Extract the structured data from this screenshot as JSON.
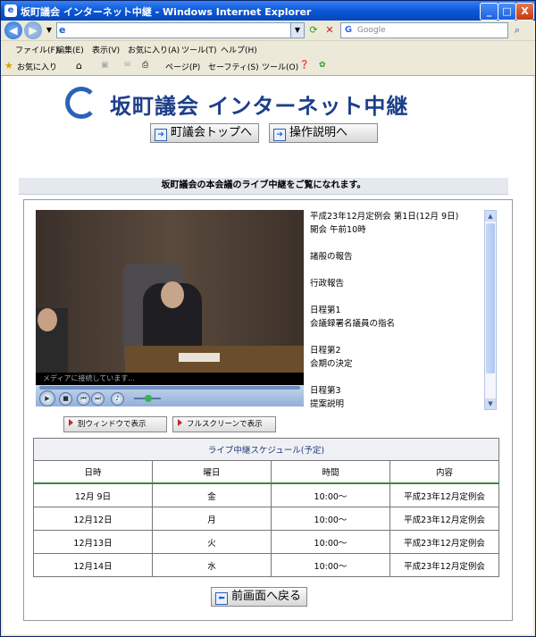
{
  "window": {
    "title": "坂町議会 インターネット中継 - Windows Internet Explorer",
    "minimize": "_",
    "maximize": "□",
    "close": "X"
  },
  "addressbar": {
    "url": "",
    "search_placeholder": "Google"
  },
  "menubar": {
    "items": [
      "ファイル(F)",
      "編集(E)",
      "表示(V)",
      "お気に入り(A)",
      "ツール(T)",
      "ヘルプ(H)"
    ]
  },
  "favbar": {
    "favorites": "お気に入り",
    "page": "ページ(P)",
    "safety": "セーフティ(S)",
    "tools": "ツール(O)"
  },
  "header": {
    "logo_text": "坂町議会 インターネット中継",
    "top_button": "町議会トップへ",
    "help_button": "操作説明へ"
  },
  "info_bar": "坂町議会の本会議のライブ中継をご覧になれます。",
  "player": {
    "status": "メディアに接続しています...",
    "popup_button": "別ウィンドウで表示",
    "fullscreen_button": "フルスクリーンで表示"
  },
  "agenda": [
    "平成23年12月定例会 第1日(12月 9日)",
    "開会 午前10時",
    "",
    "諸般の報告",
    "",
    "行政報告",
    "",
    "日程第1",
    "会議録署名議員の指名",
    "",
    "日程第2",
    "会期の決定",
    "",
    "日程第3",
    "提案説明"
  ],
  "schedule": {
    "caption": "ライブ中継スケジュール(予定)",
    "headers": [
      "日時",
      "曜日",
      "時間",
      "内容"
    ],
    "rows": [
      [
        "12月 9日",
        "金",
        "10:00～",
        "平成23年12月定例会"
      ],
      [
        "12月12日",
        "月",
        "10:00～",
        "平成23年12月定例会"
      ],
      [
        "12月13日",
        "火",
        "10:00～",
        "平成23年12月定例会"
      ],
      [
        "12月14日",
        "水",
        "10:00～",
        "平成23年12月定例会"
      ]
    ]
  },
  "back_button": "前画面へ戻る"
}
